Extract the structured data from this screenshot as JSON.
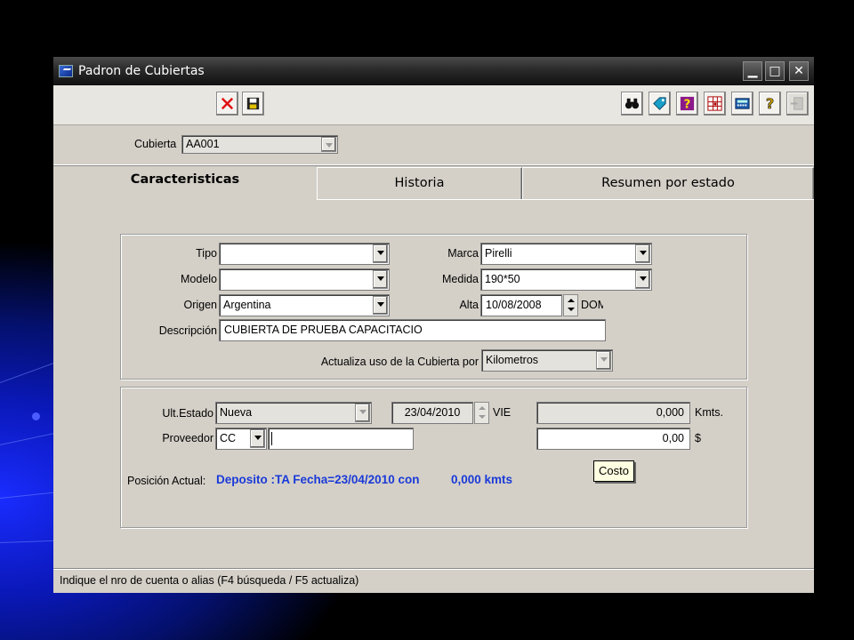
{
  "window": {
    "title": "Padron de Cubiertas",
    "controls": {
      "minimize": "▁",
      "maximize": "□",
      "close": "✕"
    }
  },
  "toolbar": {
    "left": [
      {
        "name": "cancel-button",
        "icon": "red-x-icon"
      },
      {
        "name": "save-button",
        "icon": "floppy-disk-icon"
      }
    ],
    "right": [
      {
        "name": "search-button",
        "icon": "binoculars-icon"
      },
      {
        "name": "tag-button",
        "icon": "tag-icon"
      },
      {
        "name": "help-topic-button",
        "icon": "question-box-icon"
      },
      {
        "name": "grid-button",
        "icon": "grid-icon"
      },
      {
        "name": "calculator-button",
        "icon": "calculator-icon"
      },
      {
        "name": "help-button",
        "icon": "question-mark-icon"
      },
      {
        "name": "exit-button",
        "icon": "exit-icon"
      }
    ]
  },
  "cubierta": {
    "label": "Cubierta",
    "value": "AA001"
  },
  "tabs": [
    {
      "label": "Caracteristicas",
      "active": true
    },
    {
      "label": "Historia",
      "active": false
    },
    {
      "label": "Resumen por estado",
      "active": false
    }
  ],
  "characteristics": {
    "tipo": {
      "label": "Tipo",
      "value": ""
    },
    "modelo": {
      "label": "Modelo",
      "value": ""
    },
    "origen": {
      "label": "Origen",
      "value": "Argentina"
    },
    "marca": {
      "label": "Marca",
      "value": "Pirelli"
    },
    "medida": {
      "label": "Medida",
      "value": "190*50"
    },
    "alta": {
      "label": "Alta",
      "value": "10/08/2008",
      "weekday": "DOM"
    },
    "descripcion": {
      "label": "Descripción",
      "value": "CUBIERTA DE PRUEBA CAPACITACIO"
    },
    "actualiza": {
      "label": "Actualiza uso de la Cubierta por",
      "value": "Kilometros"
    }
  },
  "status": {
    "ult_estado": {
      "label": "Ult.Estado",
      "value": "Nueva"
    },
    "fecha": {
      "value": "23/04/2010",
      "weekday": "VIE"
    },
    "kms": {
      "value": "0,000",
      "unit": "Kmts."
    },
    "proveedor": {
      "label": "Proveedor",
      "type": "CC",
      "value": ""
    },
    "costo": {
      "value": "0,00",
      "unit": "$",
      "tooltip": "Costo"
    },
    "posicion": {
      "label": "Posición Actual:",
      "value": "Deposito :TA Fecha=23/04/2010 con",
      "kms": "0,000 kmts"
    }
  },
  "statusbar": {
    "text": "Indique el nro de cuenta o alias  (F4 búsqueda / F5 actualiza)"
  }
}
